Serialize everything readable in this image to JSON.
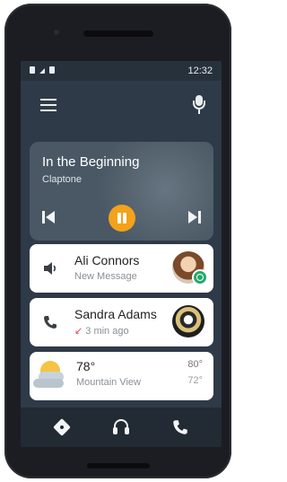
{
  "status_bar": {
    "time": "12:32"
  },
  "icons": {
    "menu": "hamburger-menu-icon",
    "voice": "microphone-icon",
    "prev": "skip-previous-icon",
    "play": "pause-icon",
    "next": "skip-next-icon",
    "message": "speaker-icon",
    "call": "phone-icon",
    "weather": "partly-cloudy-icon",
    "nav_maps": "navigation-icon",
    "nav_media": "headphones-icon",
    "nav_phone": "phone-icon"
  },
  "media": {
    "title": "In the Beginning",
    "artist": "Claptone",
    "accent": "#f3a21a"
  },
  "notifications": [
    {
      "primary": "Ali Connors",
      "secondary": "New Message"
    },
    {
      "primary": "Sandra Adams",
      "secondary": "3 min ago"
    }
  ],
  "weather": {
    "temp": "78°",
    "city": "Mountain View",
    "high": "80°",
    "low": "72°"
  },
  "colors": {
    "screen_bg": "#2e3a47",
    "card_bg": "#ffffff",
    "accent": "#f3a21a",
    "nav_bg": "#222a34"
  }
}
